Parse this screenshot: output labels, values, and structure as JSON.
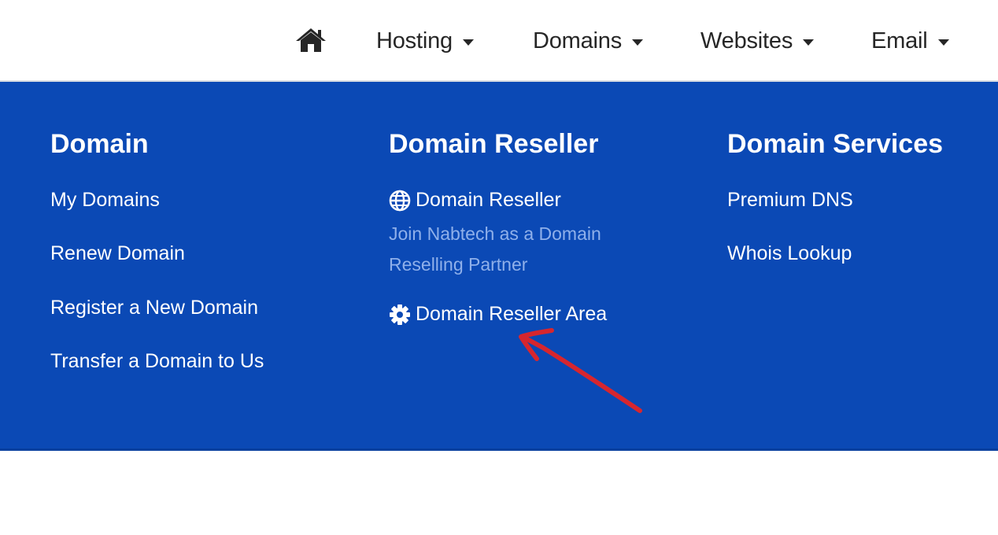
{
  "nav": {
    "home_icon": "home-icon",
    "items": [
      {
        "label": "Hosting"
      },
      {
        "label": "Domains"
      },
      {
        "label": "Websites"
      },
      {
        "label": "Email"
      }
    ]
  },
  "mega_menu": {
    "columns": [
      {
        "title": "Domain",
        "links": [
          {
            "label": "My Domains"
          },
          {
            "label": "Renew Domain"
          },
          {
            "label": "Register a New Domain"
          },
          {
            "label": "Transfer a Domain to Us"
          }
        ]
      },
      {
        "title": "Domain Reseller",
        "links": [
          {
            "label": "Domain Reseller",
            "icon": "globe-icon",
            "description": "Join Nabtech as a Domain Reselling Partner"
          },
          {
            "label": "Domain Reseller Area",
            "icon": "gear-icon"
          }
        ]
      },
      {
        "title": "Domain Services",
        "links": [
          {
            "label": "Premium DNS"
          },
          {
            "label": "Whois Lookup"
          }
        ]
      }
    ]
  },
  "colors": {
    "menu_background": "#0b49b5",
    "description_text": "#8fb0ea",
    "annotation_arrow": "#d7262e"
  }
}
